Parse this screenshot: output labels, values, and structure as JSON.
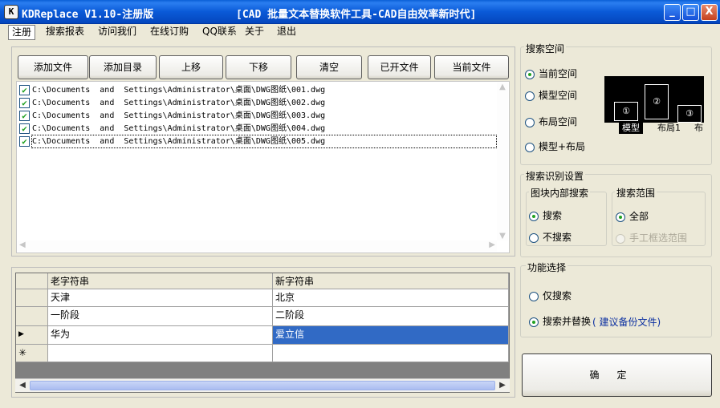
{
  "window": {
    "icon_glyph": "K",
    "title": "KDReplace V1.10-注册版",
    "subtitle": "[CAD 批量文本替换软件工具-CAD自由效率新时代]",
    "controls": {
      "minimize": "_",
      "maximize": "□",
      "close": "X"
    }
  },
  "menu": {
    "items": [
      "注册",
      "搜索报表",
      "访问我们",
      "在线订购",
      "QQ联系",
      "关于",
      "退出"
    ],
    "active_index": 0
  },
  "toolbar": {
    "buttons": [
      "添加文件",
      "添加目录",
      "上移",
      "下移",
      "清空",
      "已开文件",
      "当前文件"
    ]
  },
  "files": [
    {
      "checked": true,
      "path": "C:\\Documents  and  Settings\\Administrator\\桌面\\DWG图纸\\001.dwg"
    },
    {
      "checked": true,
      "path": "C:\\Documents  and  Settings\\Administrator\\桌面\\DWG图纸\\002.dwg"
    },
    {
      "checked": true,
      "path": "C:\\Documents  and  Settings\\Administrator\\桌面\\DWG图纸\\003.dwg"
    },
    {
      "checked": true,
      "path": "C:\\Documents  and  Settings\\Administrator\\桌面\\DWG图纸\\004.dwg"
    },
    {
      "checked": true,
      "path": "C:\\Documents  and  Settings\\Administrator\\桌面\\DWG图纸\\005.dwg",
      "selected": true
    }
  ],
  "grid": {
    "headers": [
      "老字符串",
      "新字符串"
    ],
    "rows": [
      {
        "indicator": "",
        "old": "天津",
        "new": "北京"
      },
      {
        "indicator": "",
        "old": "一阶段",
        "new": "二阶段"
      },
      {
        "indicator": "▶",
        "old": "华为",
        "new": "爱立信",
        "selected": true
      },
      {
        "indicator": "✳",
        "old": "",
        "new": ""
      }
    ]
  },
  "search_space": {
    "title": "搜索空间",
    "options": [
      "当前空间",
      "模型空间",
      "布局空间",
      "模型+布局"
    ],
    "selected": 0,
    "preview": {
      "sheet_labels": [
        "①",
        "②",
        "③"
      ],
      "tabs": [
        "模型",
        "布局1",
        "布"
      ]
    }
  },
  "search_settings": {
    "title": "搜索识别设置",
    "block_search": {
      "title": "图块内部搜索",
      "options": [
        "搜索",
        "不搜索"
      ],
      "selected": 0
    },
    "range": {
      "title": "搜索范围",
      "options": [
        "全部",
        "手工框选范围"
      ],
      "selected": 0
    }
  },
  "function_select": {
    "title": "功能选择",
    "options": [
      "仅搜索",
      "搜索并替换"
    ],
    "selected": 1,
    "hint": "( 建议备份文件)"
  },
  "ok_button": {
    "label": "确定"
  },
  "colors": {
    "title_bar": "#0a5ad8",
    "selection": "#316ac5",
    "check_green": "#21a121"
  }
}
